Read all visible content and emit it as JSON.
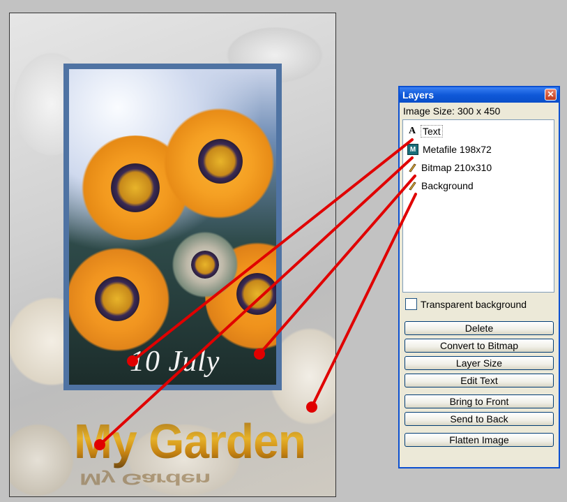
{
  "image": {
    "caption": "10 July",
    "title_art": "My Garden",
    "title_art_reflection": "My Garden"
  },
  "layers_panel": {
    "title": "Layers",
    "close_icon": "close-icon",
    "image_size": "Image Size: 300 x 450",
    "layers": [
      {
        "label": "Text",
        "icon": "text-layer-icon",
        "selected": true
      },
      {
        "label": "Metafile 198x72",
        "icon": "metafile-layer-icon",
        "selected": false
      },
      {
        "label": "Bitmap 210x310",
        "icon": "bitmap-layer-icon",
        "selected": false
      },
      {
        "label": "Background",
        "icon": "bitmap-layer-icon",
        "selected": false
      }
    ],
    "transparent_background": {
      "label": "Transparent background",
      "checked": false
    },
    "buttons": {
      "delete": "Delete",
      "convert": "Convert to Bitmap",
      "layer_size": "Layer Size",
      "edit_text": "Edit Text",
      "bring_front": "Bring to Front",
      "send_back": "Send to Back",
      "flatten": "Flatten Image"
    }
  },
  "colors": {
    "annotation": "#e00000",
    "titlebar": "#0f58d8",
    "frame": "#4f73a3"
  }
}
